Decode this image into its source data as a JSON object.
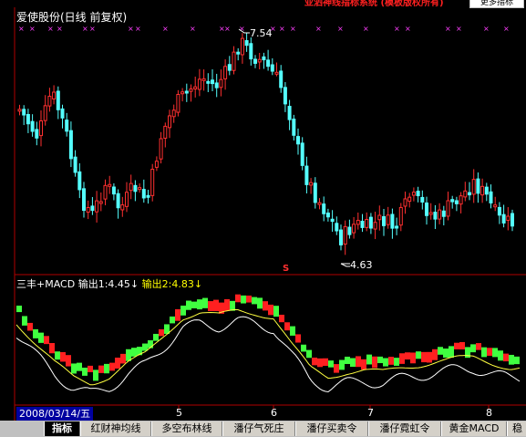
{
  "top_strip": {
    "left_text": "—— · · · —— · · · —— —— · · —— · · ·",
    "red_text": "亚泗神线指标系统 (模板版权所有)",
    "button_label": "更多指标"
  },
  "chart_title": "爱使股份(日线 前复权)",
  "high_label": "7.54",
  "low_label": "4.63",
  "signal_marker": "S",
  "indicator": {
    "name": "三丰+MACD",
    "out1": "输出1:4.45",
    "out1_arrow": "↓",
    "out2": "输出2:4.83",
    "out2_arrow": "↓"
  },
  "date": "2008/03/14/五",
  "months": [
    "5",
    "6",
    "7",
    "8"
  ],
  "tabs": [
    "指标",
    "红财神均线",
    "多空布林线",
    "潘仔气死庄",
    "潘仔买卖令",
    "潘仔霓虹令",
    "黄金MACD",
    "稳"
  ],
  "colors": {
    "up": "#ff3030",
    "down": "#54ffff",
    "accent_red": "#b00000",
    "marker": "#ff40ff"
  },
  "chart_data": {
    "type": "candlestick",
    "title": "爱使股份(日线 前复权)",
    "period": "daily",
    "x_categories": [
      "5",
      "6",
      "7",
      "8"
    ],
    "annotations": [
      {
        "label": "7.54",
        "type": "high"
      },
      {
        "label": "4.63",
        "type": "low"
      }
    ],
    "indicator_outputs": [
      4.45,
      4.83
    ]
  }
}
